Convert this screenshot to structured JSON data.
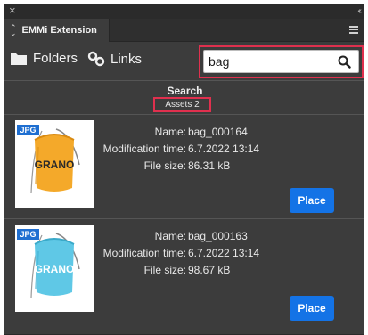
{
  "titlebar": {
    "close_glyph": "×",
    "collapse_glyph": "‹‹"
  },
  "tab": {
    "label": "EMMi Extension",
    "arrows_icon": "up-down-arrows-icon",
    "menu_icon": "hamburger-menu-icon"
  },
  "toolbar": {
    "folders_label": "Folders",
    "links_label": "Links",
    "folders_icon": "folder-icon",
    "links_icon": "link-icon"
  },
  "search": {
    "value": "bag",
    "placeholder": "",
    "icon": "search-icon"
  },
  "results": {
    "title": "Search",
    "assets_count": "Assets 2"
  },
  "assets": [
    {
      "badge": "JPG",
      "name_label": "Name:",
      "name": "bag_000164",
      "mod_label": "Modification time:",
      "mod_time": "6.7.2022 13:14",
      "size_label": "File size:",
      "size": "86.31 kB",
      "place_label": "Place",
      "thumb_color": "#f4a92a",
      "print": "GRANO"
    },
    {
      "badge": "JPG",
      "name_label": "Name:",
      "name": "bag_000163",
      "mod_label": "Modification time:",
      "mod_time": "6.7.2022 13:14",
      "size_label": "File size:",
      "size": "98.67 kB",
      "place_label": "Place",
      "thumb_color": "#5fc8e6",
      "print": "GRANO"
    }
  ],
  "colors": {
    "accent": "#1473e6",
    "highlight": "#e0304e",
    "panel": "#3c3c3c"
  }
}
